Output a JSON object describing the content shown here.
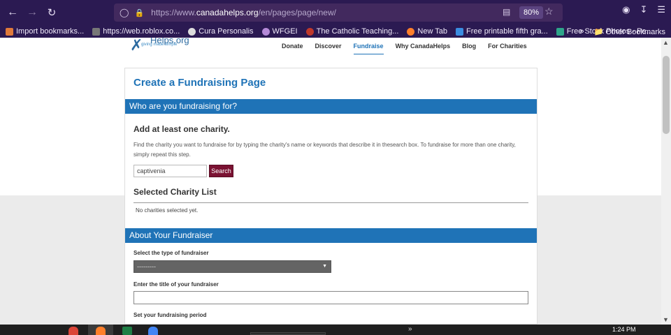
{
  "browser": {
    "url_prefix": "https://www.",
    "url_domain": "canadahelps.org",
    "url_path": "/en/pages/page/new/",
    "zoom": "80%",
    "bookmarks": [
      {
        "label": "Import bookmarks...",
        "color": "#e07a3a"
      },
      {
        "label": "https://web.roblox.co...",
        "color": "#777777"
      },
      {
        "label": "Cura Personalis",
        "color": "#dddddd"
      },
      {
        "label": "WFGEI",
        "color": "#b58ad8"
      },
      {
        "label": "The Catholic Teaching...",
        "color": "#c0392b"
      },
      {
        "label": "New Tab",
        "color": "#ff7f2a"
      },
      {
        "label": "Free printable fifth gra...",
        "color": "#3a8de0"
      },
      {
        "label": "Free Stock Photos - Pe...",
        "color": "#2ea58a"
      }
    ],
    "other_bookmarks": "Other Bookmarks"
  },
  "site": {
    "logo_name": "Helps.org",
    "logo_tagline": "giving made simple",
    "nav": [
      "Donate",
      "Discover",
      "Fundraise",
      "Why CanadaHelps",
      "Blog",
      "For Charities"
    ],
    "active_nav": "Fundraise"
  },
  "form": {
    "title": "Create a Fundraising Page",
    "section1": "Who are you fundraising for?",
    "add_charity_heading": "Add at least one charity.",
    "help_text": "Find the charity you want to fundraise for by typing the charity's name or keywords that describe it in thesearch box. To fundraise for more than one charity, simply repeat this step.",
    "search_value": "captivenia",
    "search_button": "Search",
    "selected_heading": "Selected Charity List",
    "no_charities": "No charities selected yet.",
    "section2": "About Your Fundraiser",
    "type_label": "Select the type of fundraiser",
    "type_value": "---------",
    "title_label": "Enter the title of your fundraiser",
    "period_label": "Set your fundraising period"
  },
  "taskbar": {
    "time": "1:24 PM"
  }
}
